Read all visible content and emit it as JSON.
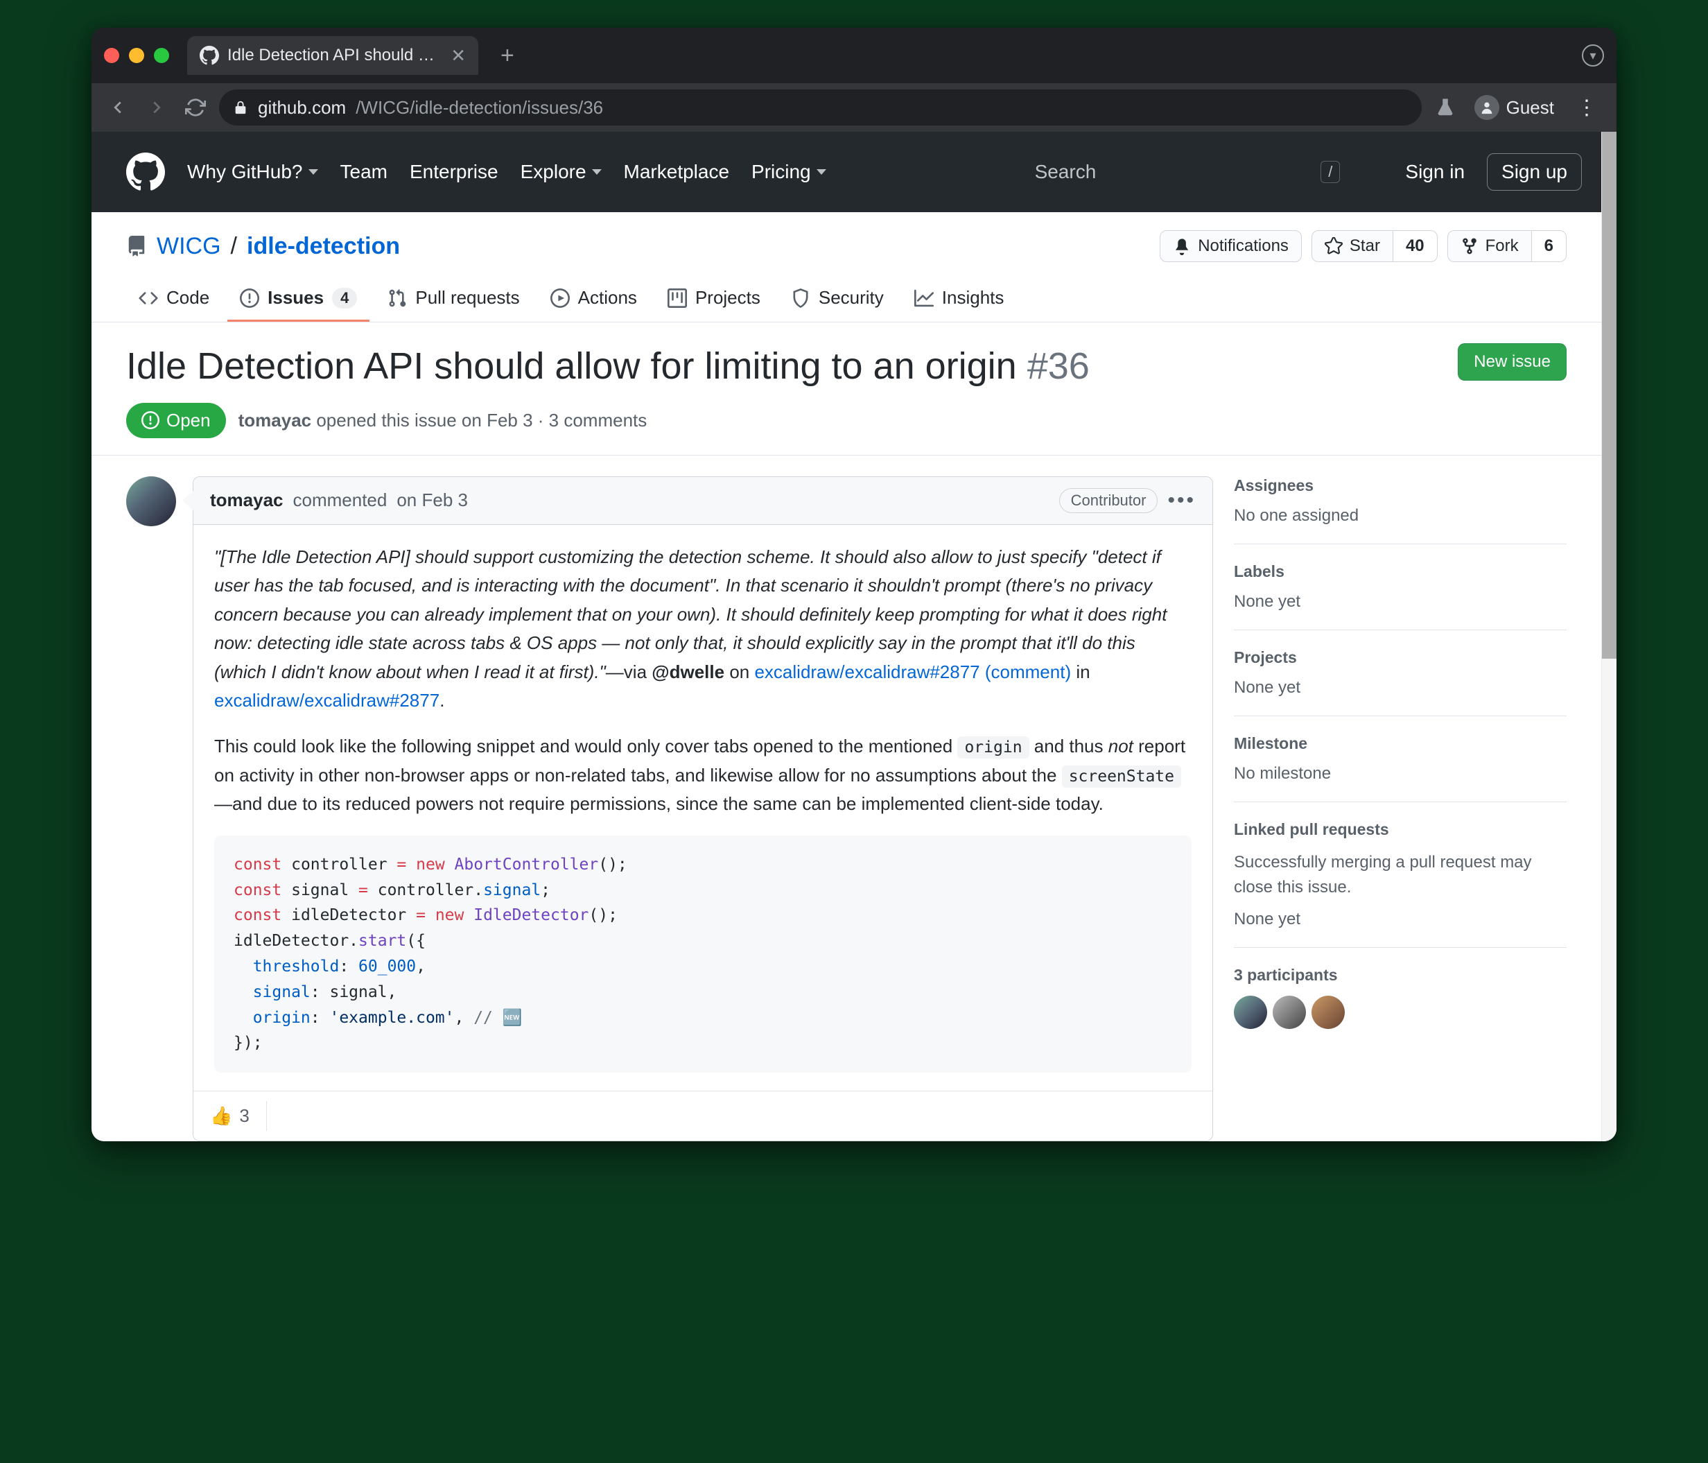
{
  "browser": {
    "tab_title": "Idle Detection API should allow",
    "url_host": "github.com",
    "url_path": "/WICG/idle-detection/issues/36",
    "guest_label": "Guest"
  },
  "gh_header": {
    "why": "Why GitHub?",
    "team": "Team",
    "enterprise": "Enterprise",
    "explore": "Explore",
    "marketplace": "Marketplace",
    "pricing": "Pricing",
    "search_placeholder": "Search",
    "signin": "Sign in",
    "signup": "Sign up"
  },
  "repo": {
    "owner": "WICG",
    "name": "idle-detection",
    "notifications": "Notifications",
    "star": "Star",
    "star_count": "40",
    "fork": "Fork",
    "fork_count": "6"
  },
  "repo_tabs": {
    "code": "Code",
    "issues": "Issues",
    "issues_count": "4",
    "pulls": "Pull requests",
    "actions": "Actions",
    "projects": "Projects",
    "security": "Security",
    "insights": "Insights"
  },
  "issue": {
    "title": "Idle Detection API should allow for limiting to an origin",
    "number": "#36",
    "new_issue": "New issue",
    "state": "Open",
    "author": "tomayac",
    "opened_text": " opened this issue on Feb 3 · 3 comments"
  },
  "comment": {
    "author": "tomayac",
    "commented_label": " commented ",
    "date": "on Feb 3",
    "contributor": "Contributor",
    "quote": "\"[The Idle Detection API] should support customizing the detection scheme. It should also allow to just specify \"detect if user has the tab focused, and is interacting with the document\". In that scenario it shouldn't prompt (there's no privacy concern because you can already implement that on your own). It should definitely keep prompting for what it does right now: detecting idle state across tabs & OS apps — not only that, it should explicitly say in the prompt that it'll do this (which I didn't know about when I read it at first).\"",
    "via": "—via ",
    "mention": "@dwelle",
    "on": " on ",
    "link1": "excalidraw/excalidraw#2877 (comment)",
    "in": " in ",
    "link2": "excalidraw/excalidraw#2877",
    "p2_a": "This could look like the following snippet and would only cover tabs opened to the mentioned ",
    "code_origin": "origin",
    "p2_b": " and thus ",
    "not": "not",
    "p2_c": " report on activity in other non-browser apps or non-related tabs, and likewise allow for no assumptions about the ",
    "code_screen": "screenState",
    "p2_d": " —and due to its reduced powers not require permissions, since the same can be implemented client-side today.",
    "reaction_count": "3"
  },
  "code": {
    "l1a": "const",
    "l1b": " controller ",
    "l1c": "=",
    "l1d": " new",
    "l1e": " AbortController",
    "l1f": "();",
    "l2a": "const",
    "l2b": " signal ",
    "l2c": "=",
    "l2d": " controller.",
    "l2e": "signal",
    "l2f": ";",
    "l3a": "const",
    "l3b": " idleDetector ",
    "l3c": "=",
    "l3d": " new",
    "l3e": " IdleDetector",
    "l3f": "();",
    "l4a": "idleDetector.",
    "l4b": "start",
    "l4c": "({",
    "l5a": "  threshold",
    "l5b": ": ",
    "l5c": "60_000",
    "l5d": ",",
    "l6a": "  signal",
    "l6b": ": signal,",
    "l7a": "  origin",
    "l7b": ": ",
    "l7c": "'example.com'",
    "l7d": ", ",
    "l7e": "// 🆕",
    "l8": "});"
  },
  "sidebar": {
    "assignees": "Assignees",
    "assignees_val": "No one assigned",
    "labels": "Labels",
    "labels_val": "None yet",
    "projects": "Projects",
    "projects_val": "None yet",
    "milestone": "Milestone",
    "milestone_val": "No milestone",
    "linked": "Linked pull requests",
    "linked_desc": "Successfully merging a pull request may close this issue.",
    "linked_val": "None yet",
    "participants": "3 participants"
  }
}
